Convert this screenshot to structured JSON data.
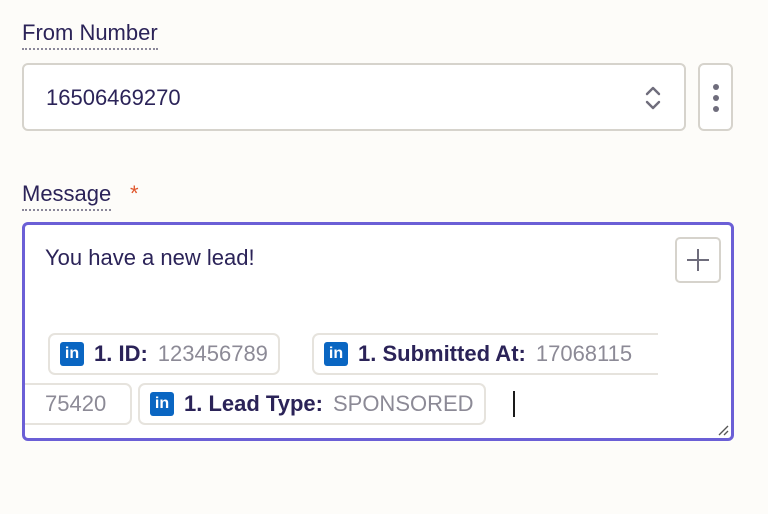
{
  "from_number": {
    "label": "From Number",
    "value": "16506469270"
  },
  "message": {
    "label": "Message",
    "required_mark": "*",
    "text": "You have a new lead!",
    "tokens": [
      {
        "key": "1. ID:",
        "value": "123456789"
      },
      {
        "key": "1. Submitted At:",
        "value": "17068115"
      },
      {
        "key": "",
        "value": "75420"
      },
      {
        "key": "1. Lead Type:",
        "value": "SPONSORED"
      }
    ],
    "token_icon": "linkedin-icon",
    "token_icon_text": "in"
  },
  "colors": {
    "accent": "#6b5fd6",
    "required": "#e0562c",
    "linkedin": "#0a66c2"
  }
}
